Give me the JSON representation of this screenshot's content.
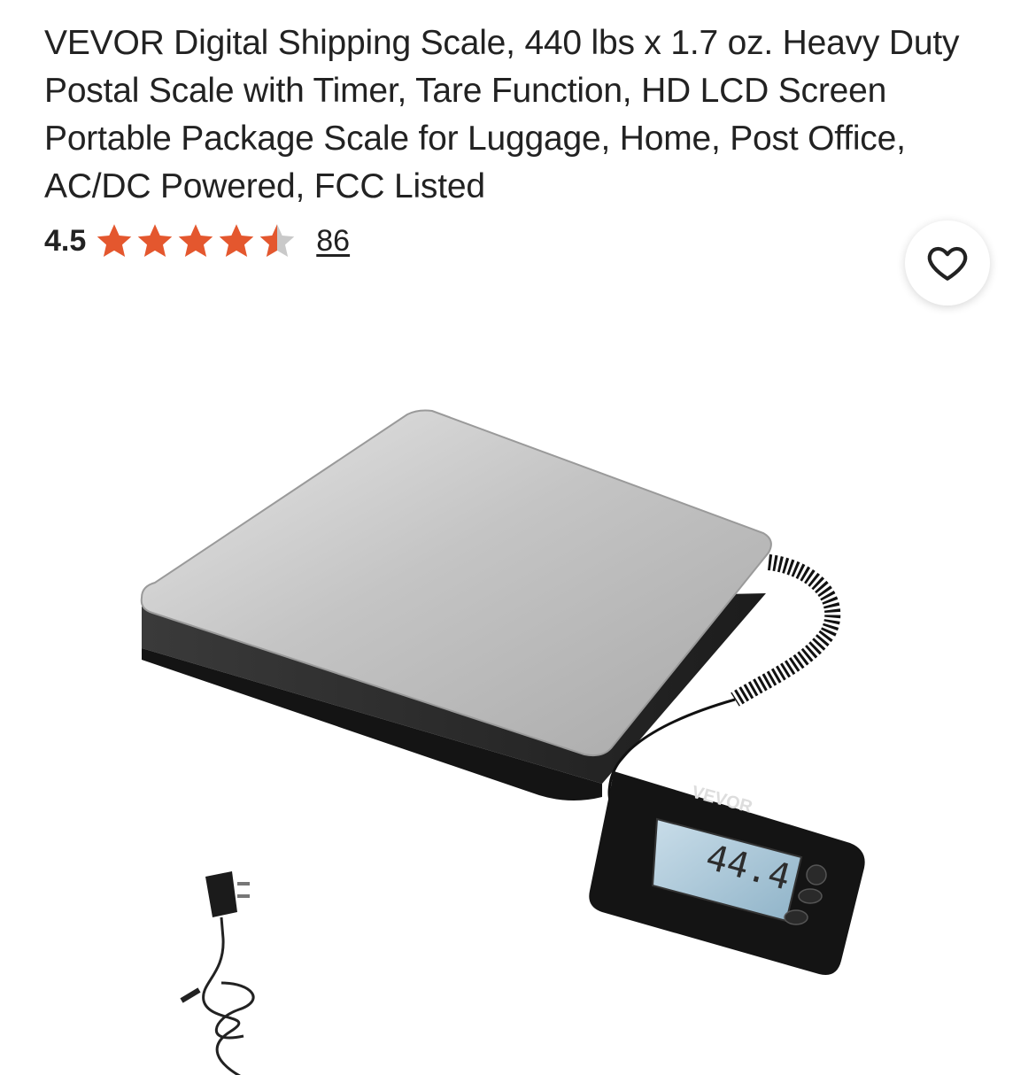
{
  "product": {
    "title": "VEVOR Digital Shipping Scale, 440 lbs x 1.7 oz. Heavy Duty Postal Scale with Timer, Tare Function, HD LCD Screen Portable Package Scale for Luggage, Home, Post Office, AC/DC Powered, FCC Listed",
    "rating": "4.5",
    "rating_value": 4.5,
    "rating_max": 5,
    "review_count": "86"
  },
  "colors": {
    "star_filled": "#e4572e",
    "star_empty": "#c9c9c9",
    "text": "#222222"
  },
  "icons": {
    "favorite": "heart-outline-icon",
    "star": "star-icon"
  },
  "image": {
    "scale_display_brand": "VEVOR",
    "scale_display_reading": "44.4",
    "scale_button_power": "⏻"
  }
}
